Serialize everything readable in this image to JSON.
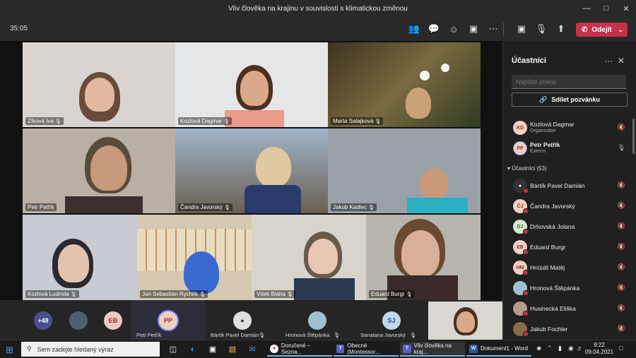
{
  "window": {
    "title": "Vliv člověka na krajinu v souvislosti s klimatickou změnou"
  },
  "toolbar": {
    "timer": "35:05",
    "leave_label": "Odejít"
  },
  "tiles": [
    {
      "name": "Zíková Iva"
    },
    {
      "name": "Kozlová Dagmar"
    },
    {
      "name": "Marta Salajková"
    },
    {
      "name": "Petr Petřík"
    },
    {
      "name": "Čandra Javorský"
    },
    {
      "name": "Jakub Kadlec"
    },
    {
      "name": "Kozlová Ludmila"
    },
    {
      "name": "Jan Sebastián Rychlík"
    },
    {
      "name": "Vítek Bláha"
    },
    {
      "name": "Eduard Burgr"
    }
  ],
  "strip": {
    "more": "+48",
    "eb": "EB",
    "pp": "PP",
    "pp_name": "Petr Petřík",
    "bartik": "Bártík Pavel Damián",
    "hronova": "Hronová Štěpánka",
    "sj": "SJ",
    "sanatana": "Sanatana Javorský"
  },
  "panel": {
    "title": "Účastníci",
    "search_placeholder": "Napište jméno",
    "share_label": "Sdílet pozvánku",
    "organizers": [
      {
        "initials": "KD",
        "name": "Kozlová Dagmar",
        "sub": "Organizátor"
      },
      {
        "initials": "PP",
        "name": "Petr Petřík",
        "sub": "Externí"
      }
    ],
    "section": "Účastníci (53)",
    "attendees": [
      {
        "initials": "",
        "name": "Bártík Pavel Damián"
      },
      {
        "initials": "ČJ",
        "name": "Čandra Javorský"
      },
      {
        "initials": "DJ",
        "name": "Drhovská Jolana"
      },
      {
        "initials": "EB",
        "name": "Eduard Burgr"
      },
      {
        "initials": "HM",
        "name": "Hnízdil Matěj"
      },
      {
        "initials": "",
        "name": "Hronová Štěpánka"
      },
      {
        "initials": "",
        "name": "Husinecká Eliška"
      },
      {
        "initials": "",
        "name": "Jakub Fochler"
      }
    ]
  },
  "taskbar": {
    "search": "Sem zadejte hledaný výraz",
    "apps": [
      "Doručené – Sezna...",
      "Obecné (Montessor...",
      "Vliv člověka na kraj...",
      "Dokument1 - Word"
    ],
    "time": "9:22",
    "date": "09.04.2021"
  }
}
